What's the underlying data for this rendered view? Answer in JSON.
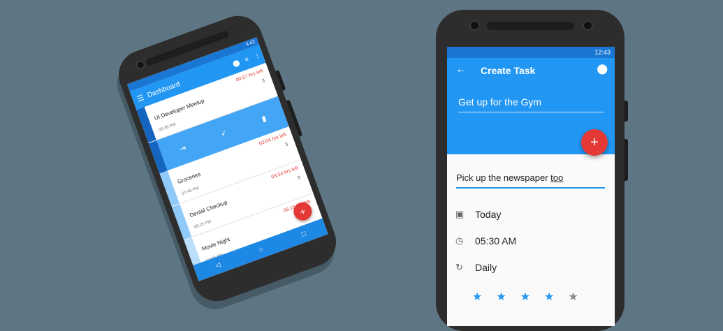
{
  "left_phone": {
    "status_time": "4:42",
    "appbar": {
      "title": "Dashboard",
      "menu_icon": "☰",
      "location_icon": "⬤",
      "sort_icon": "≡",
      "more_icon": "⋮"
    },
    "actions": {
      "move_icon": "⇥",
      "done_icon": "✓",
      "delete_icon": "▮"
    },
    "tasks": [
      {
        "name": "UI Developer Meetup",
        "time": "05:38 PM",
        "left": "00:57 hrs left",
        "count": "3",
        "color": "#1565c0"
      },
      {
        "name": "Groceries",
        "time": "07:45 PM",
        "left": "03:04 hrs left",
        "count": "3",
        "color": "#90caf9"
      },
      {
        "name": "Dental Checkup",
        "time": "08:15 PM",
        "left": "03:34 hrs left",
        "count": "3",
        "color": "#90caf9"
      },
      {
        "name": "Movie Night",
        "time": "11:00 PM",
        "left": "06:19 hrs left",
        "count": "",
        "color": "#bbdefb"
      }
    ],
    "fab": "+",
    "nav": {
      "back": "◁",
      "home": "○",
      "recent": "□"
    }
  },
  "right_phone": {
    "status_time": "12:43",
    "title": "Create Task",
    "back_icon": "←",
    "location_icon": "⬤",
    "task_title": "Get up for the Gym",
    "fab": "+",
    "note_main": "Pick up the newspaper ",
    "note_underlined": "too",
    "date": {
      "icon": "▣",
      "label": "Today"
    },
    "time": {
      "icon": "◷",
      "label": "05:30 AM"
    },
    "repeat": {
      "icon": "↻",
      "label": "Daily"
    },
    "rating": {
      "value": 4,
      "max": 5,
      "on_color": "#2196f3",
      "off_color": "#8a8a8a"
    }
  }
}
